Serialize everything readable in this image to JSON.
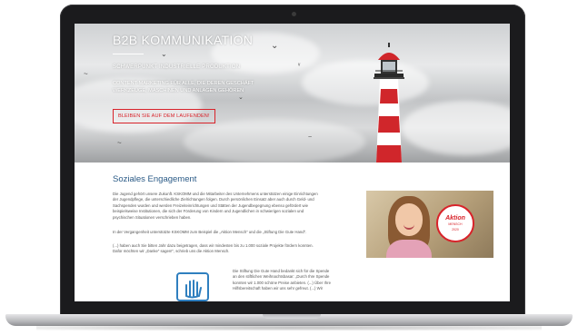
{
  "hero": {
    "title": "B2B KOMMUNIKATION",
    "subtitle": "SCHWERPUNKT INDUSTRIELLE PRODUKTION",
    "description_line1": "CONTENT-MARKETING FÜR ALLE, DIE DEREN GESCHÄFT",
    "description_line2": "WERKZEUGE, MASCHINEN UND ANLAGEN GEHÖREN",
    "cta_label": "BLEIBEN SIE AUF DEM LAUFENDEN!"
  },
  "section": {
    "title": "Soziales Engagement",
    "paragraph1": "Die Jugend gehört unsere Zukunft. KSKOMM und die Mitarbeiter des Unternehmens unterstützen einige Einrichtungen der Jugendpflege, die unterschiedliche Zielrichtungen folgen. Durch persönlichen Einsatz aber auch durch Geld- und Sachspenden wurden und werden Freizeiteinrichtungen und Stätten der Jugendbegegnung ebenso gefördert wie beispielsweise Institutionen, die sich der Förderung von Kindern und Jugendlichen in schwierigen sozialen und psychischen Situationen verschrieben haben.",
    "paragraph2": "In der Vergangenheit unterstützte KSKOMM zum Beispiel die „Aktion Mensch“ und die „Stiftung Die Gute Hand“.",
    "paragraph3": "(...) haben auch Sie bitten Jahr dazu beigetragen, dass wir mindesten bis zu 1.000 soziale Projekte fördern konnten. Dafür möchten wir „Danke“ sagen!“, schrieb uns die Aktion Mensch.",
    "paragraph4": "Die Stiftung Die Gute Hand bedankt sich für die Spende an den stiftlichen Weihnachtsbasar: „Durch Ihre Spende konnten wir 1.000 schöne Preise anbieten. (...) Über Ihre Hilfsbereitschaft haben wir uns sehr gefreut. (...) Wir"
  },
  "badge": {
    "word": "Aktion",
    "sub": "MENSCH",
    "year": "2020"
  },
  "colors": {
    "accent_red": "#d8232a",
    "title_blue": "#2a5a86",
    "icon_blue": "#2f7fbf"
  }
}
